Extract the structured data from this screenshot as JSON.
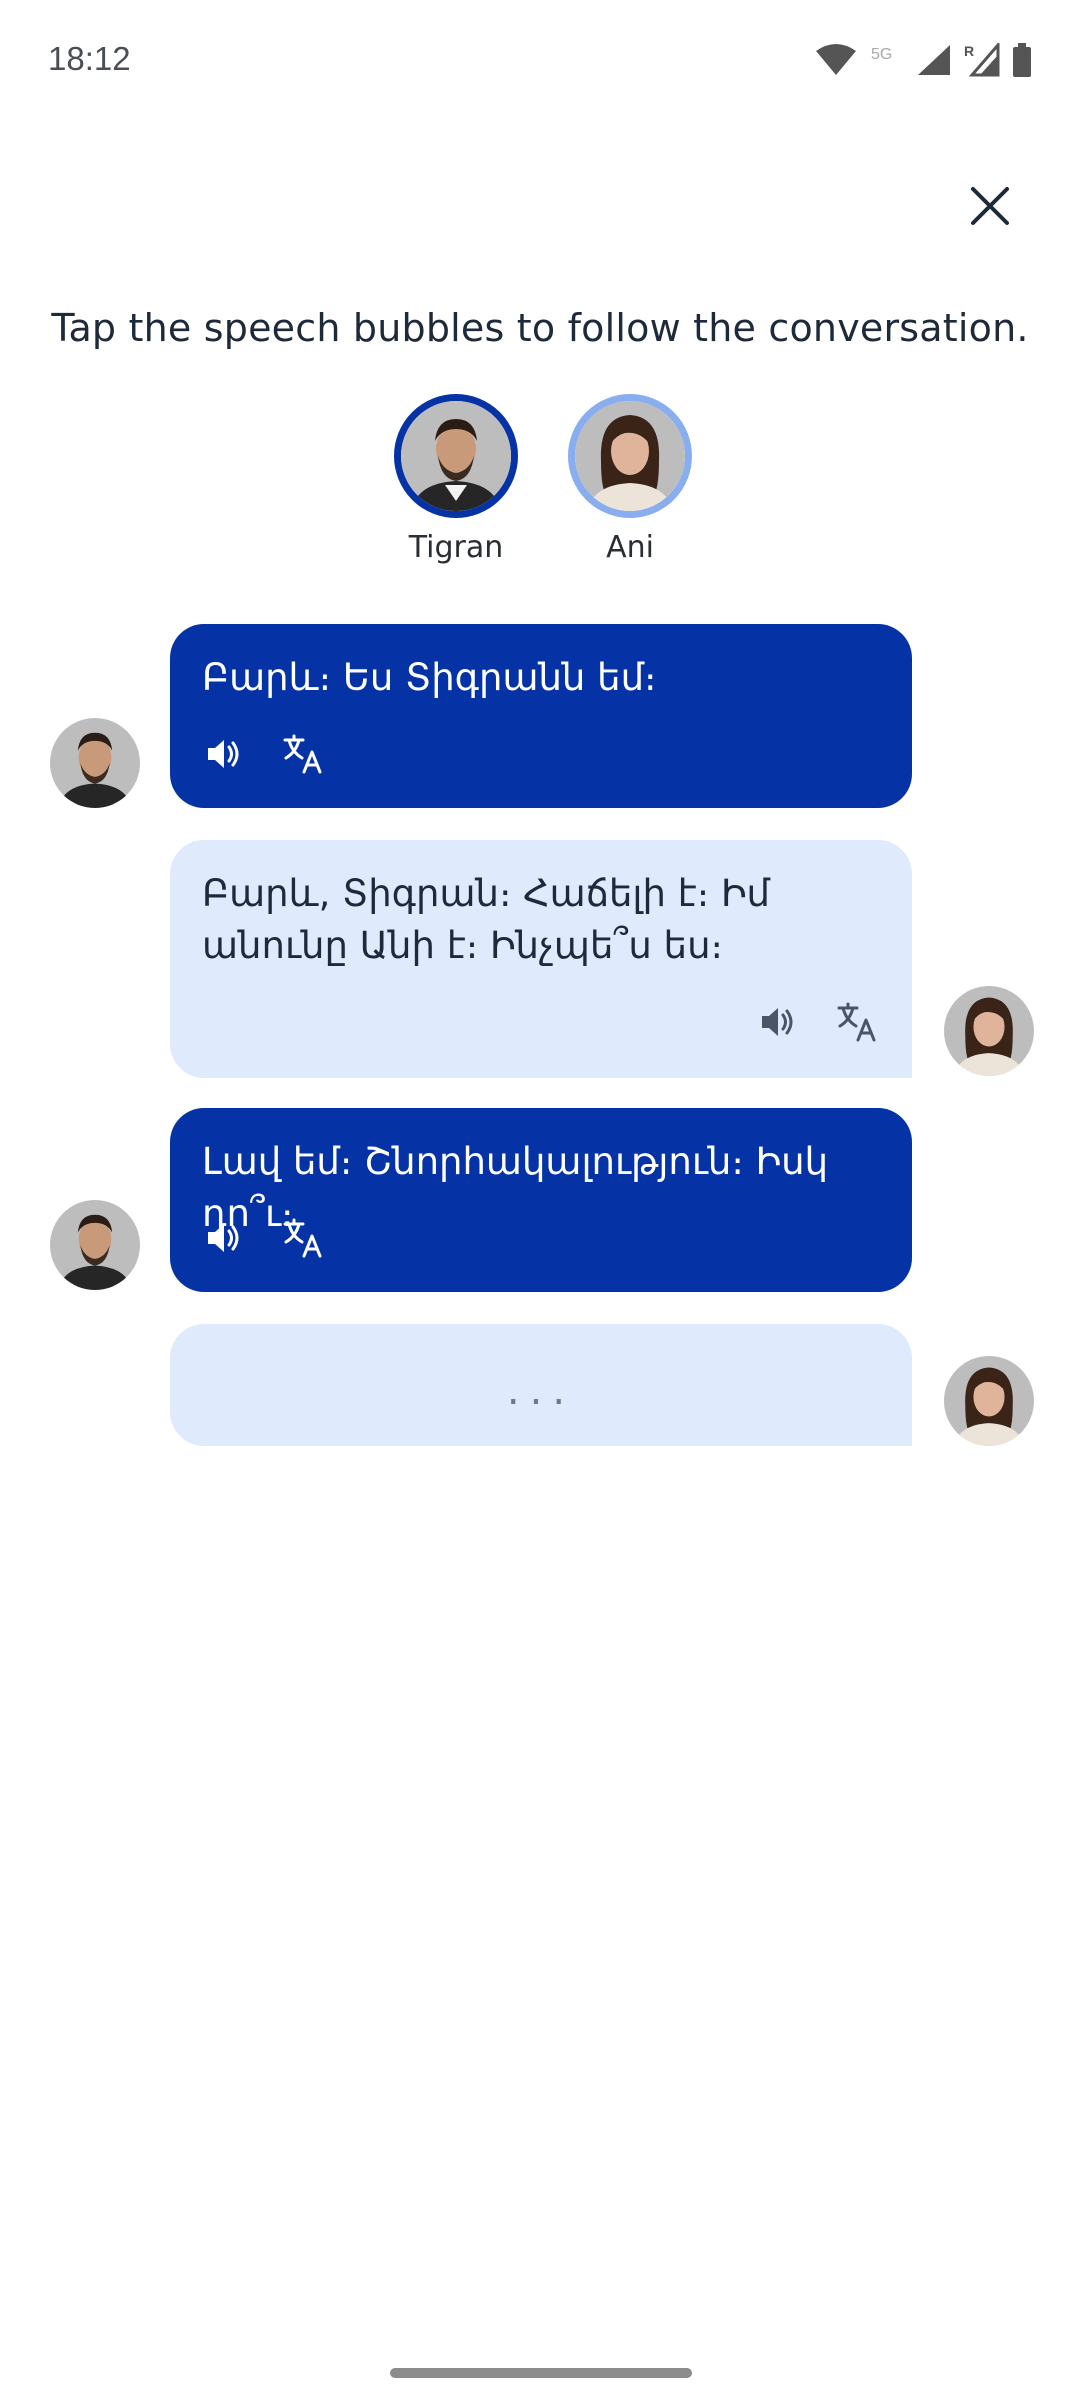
{
  "status_bar": {
    "time": "18:12",
    "network_label": "5G",
    "roaming_label": "R"
  },
  "header": {
    "instruction": "Tap the speech bubbles to follow the conversation."
  },
  "participants": [
    {
      "name": "Tigran",
      "active": true
    },
    {
      "name": "Ani",
      "active": false
    }
  ],
  "messages": [
    {
      "speaker": "Tigran",
      "text": "Բարև։ Ես Տիգրանն եմ։"
    },
    {
      "speaker": "Ani",
      "text": "Բարև, Տիգրան։ Հաճելի է։ Իմ անունը Անի է։ Ինչպե՞ս ես։"
    },
    {
      "speaker": "Tigran",
      "text": "Լավ եմ։ Շնորհակալություն։ Իսկ դո՞ւ։"
    },
    {
      "speaker": "Ani",
      "text": "..."
    }
  ],
  "colors": {
    "primary": "#0533a5",
    "light_bubble": "#dfeafd",
    "ring_inactive": "#88aef0"
  }
}
